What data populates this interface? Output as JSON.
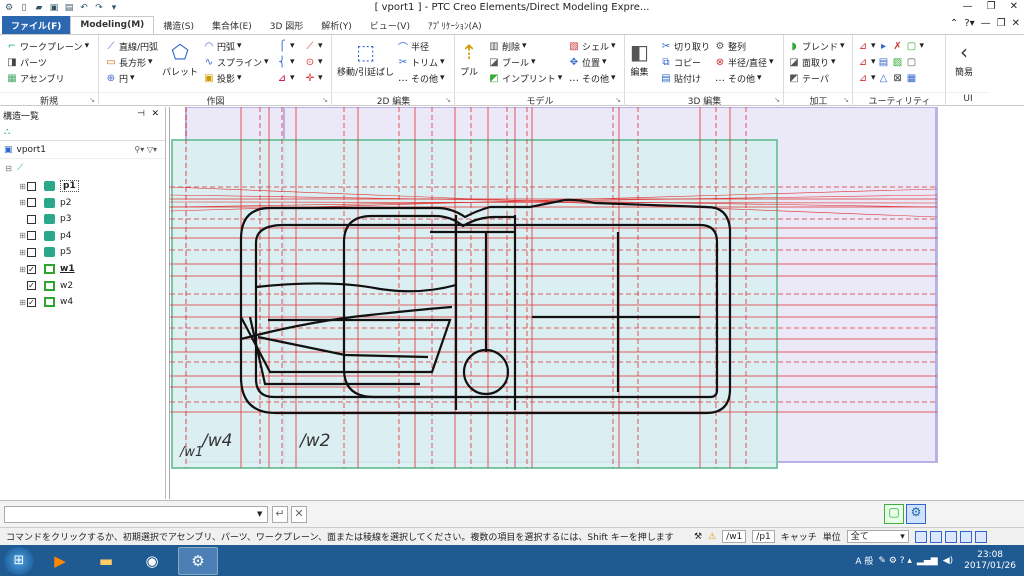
{
  "window": {
    "title": "[ vport1 ] - PTC Creo Elements/Direct Modeling Expre..."
  },
  "tabs": [
    {
      "label": "ファイル(F)",
      "kind": "file"
    },
    {
      "label": "Modeling(M)",
      "kind": "active"
    },
    {
      "label": "構造(S)"
    },
    {
      "label": "集合体(E)"
    },
    {
      "label": "3D 図形"
    },
    {
      "label": "解析(Y)"
    },
    {
      "label": "ビュー(V)"
    },
    {
      "label": "ｱﾌﾟﾘｹｰｼｮﾝ(A)"
    }
  ],
  "ribbon": {
    "groups": [
      "新規",
      "作図",
      "2D 編集",
      "モデル",
      "3D 編集",
      "加工",
      "ユーティリティ",
      "UI"
    ],
    "new": {
      "workplane": "ワークプレーン",
      "parts": "パーツ",
      "assembly": "アセンブリ"
    },
    "draw": {
      "line": "直線/円弧",
      "rect": "長方形",
      "circle": "円",
      "palette": "パレット",
      "arc": "円弧",
      "spline": "スプライン",
      "project": "投影"
    },
    "edit2d": {
      "move": "移動/引延ばし",
      "radius": "半径",
      "trim": "トリム",
      "other": "その他"
    },
    "model": {
      "pull": "プル",
      "delete": "削除",
      "boole": "ブール",
      "imprint": "インプリント",
      "shell": "シェル",
      "position": "位置",
      "other": "その他"
    },
    "edit3d": {
      "edit": "編集",
      "cut": "切り取り",
      "copy": "コピー",
      "paste": "貼付け",
      "align": "整列",
      "radius": "半径/直径",
      "other": "その他"
    },
    "machining": {
      "blend": "ブレンド",
      "chamfer": "面取り",
      "taper": "テーパ"
    },
    "ui": {
      "simple": "簡易"
    }
  },
  "structure": {
    "title": "構造一覧",
    "root": "vport1",
    "items": [
      {
        "label": "p1",
        "type": "part",
        "checked": false,
        "expand": true,
        "selected": true
      },
      {
        "label": "p2",
        "type": "part",
        "checked": false,
        "expand": true
      },
      {
        "label": "p3",
        "type": "part",
        "checked": false,
        "expand": false
      },
      {
        "label": "p4",
        "type": "part",
        "checked": false,
        "expand": true
      },
      {
        "label": "p5",
        "type": "part",
        "checked": false,
        "expand": true
      },
      {
        "label": "w1",
        "type": "wp",
        "checked": true,
        "expand": true,
        "bold": true
      },
      {
        "label": "w2",
        "type": "wp",
        "checked": true,
        "expand": false
      },
      {
        "label": "w4",
        "type": "wp",
        "checked": true,
        "expand": true
      }
    ]
  },
  "viewport": {
    "labels": [
      "/w4",
      "/w2",
      "/w1"
    ]
  },
  "statusbar": {
    "message": "コマンドをクリックするか、初期選択でアセンブリ、パーツ、ワークプレーン、面または稜線を選択してください。複数の項目を選択するには、Shift キーを押します",
    "wp": "/w1",
    "part": "/p1",
    "catch": "キャッチ",
    "unit_label": "単位",
    "unit_value": "全て"
  },
  "taskbar": {
    "time": "23:08",
    "date": "2017/01/26",
    "ime": "A 般"
  },
  "colors": {
    "file_tab": "#2b68b0",
    "workplane_fill": "#d8eef0",
    "workplane_border": "#7cc6a8",
    "constraint": "#e03030",
    "geometry": "#111111"
  }
}
